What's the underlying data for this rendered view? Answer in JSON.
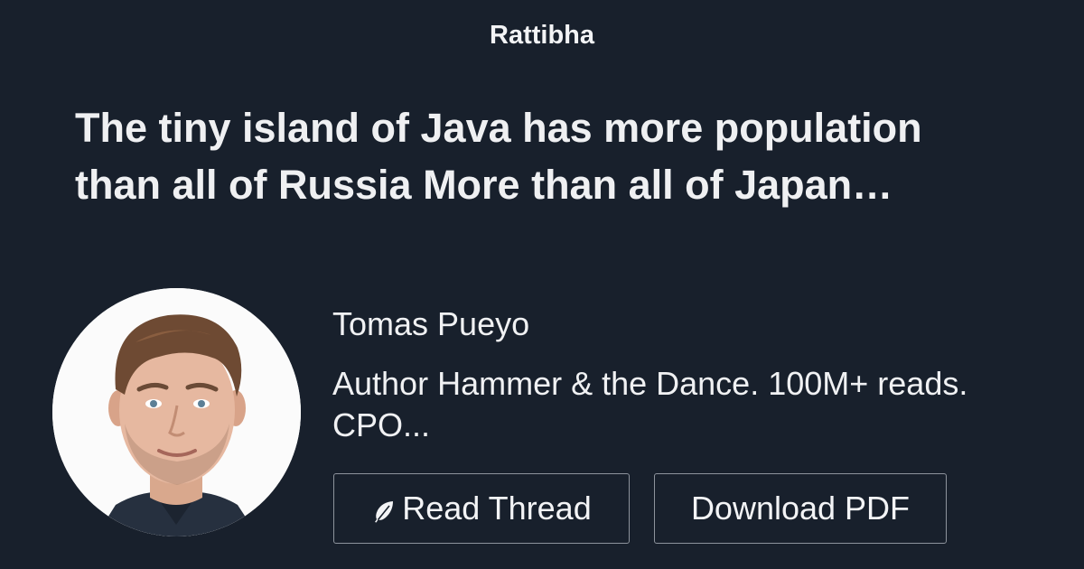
{
  "header": {
    "brand": "Rattibha"
  },
  "thread": {
    "title": "The tiny island of Java has more population than all of Russia More than all of Japan…"
  },
  "author": {
    "name": "Tomas Pueyo",
    "bio": "Author Hammer & the Dance. 100M+ reads. CPO..."
  },
  "actions": {
    "read_label": "Read Thread",
    "read_icon": "feather-icon",
    "download_label": "Download PDF"
  },
  "colors": {
    "background": "#18202c",
    "text": "#eef0f3",
    "button_border": "#8d939c"
  }
}
